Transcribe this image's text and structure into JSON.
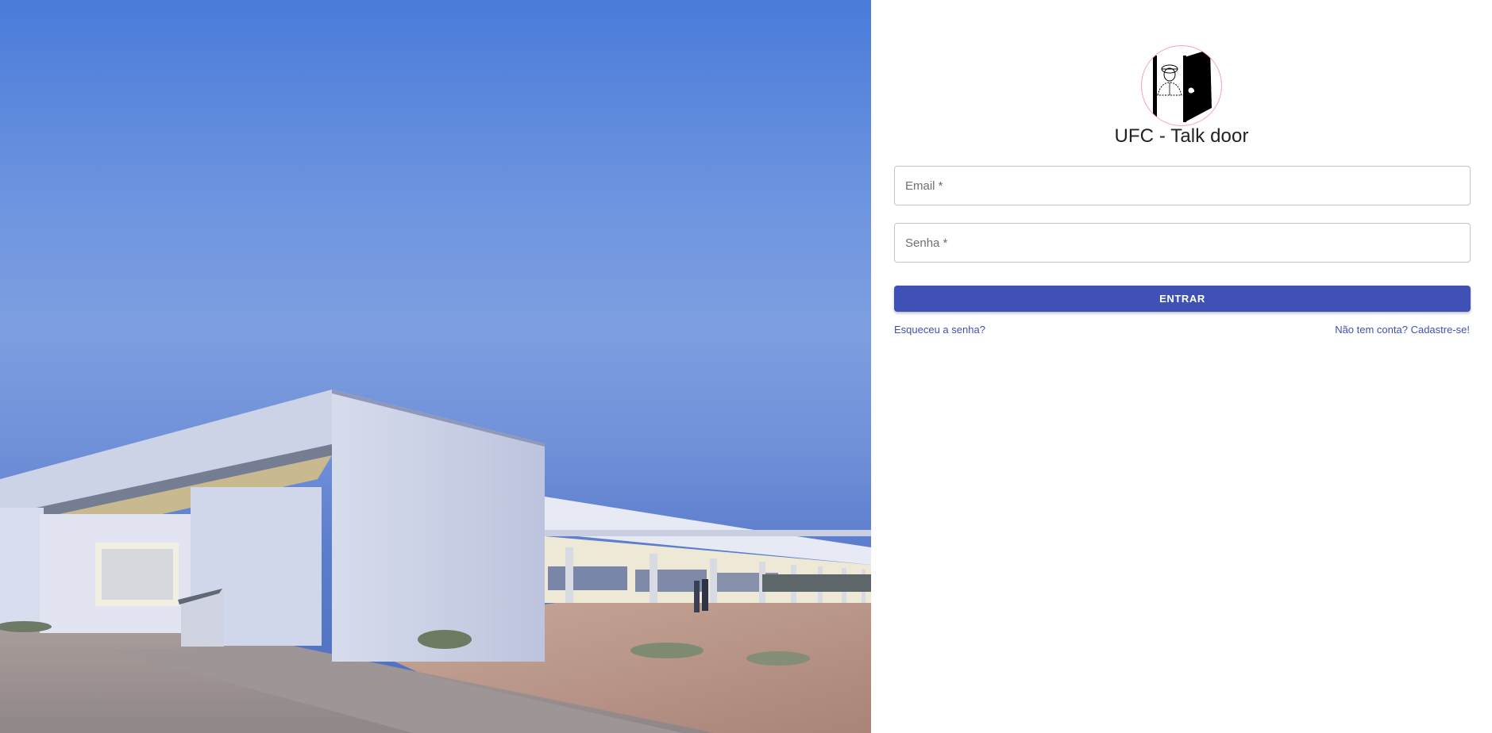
{
  "app": {
    "title": "UFC - Talk door",
    "logo_icon": "door-person-logo-icon"
  },
  "form": {
    "email": {
      "placeholder": "Email *",
      "value": ""
    },
    "password": {
      "placeholder": "Senha *",
      "value": ""
    },
    "submit_label": "ENTRAR"
  },
  "links": {
    "forgot_password": "Esqueceu a senha?",
    "signup": "Não tem conta? Cadastre-se!"
  },
  "hero": {
    "image": "campus-building-photo"
  },
  "colors": {
    "primary": "#3f51b5",
    "logo_border": "#f4a6b4",
    "sky_top": "#4a7bd9"
  }
}
